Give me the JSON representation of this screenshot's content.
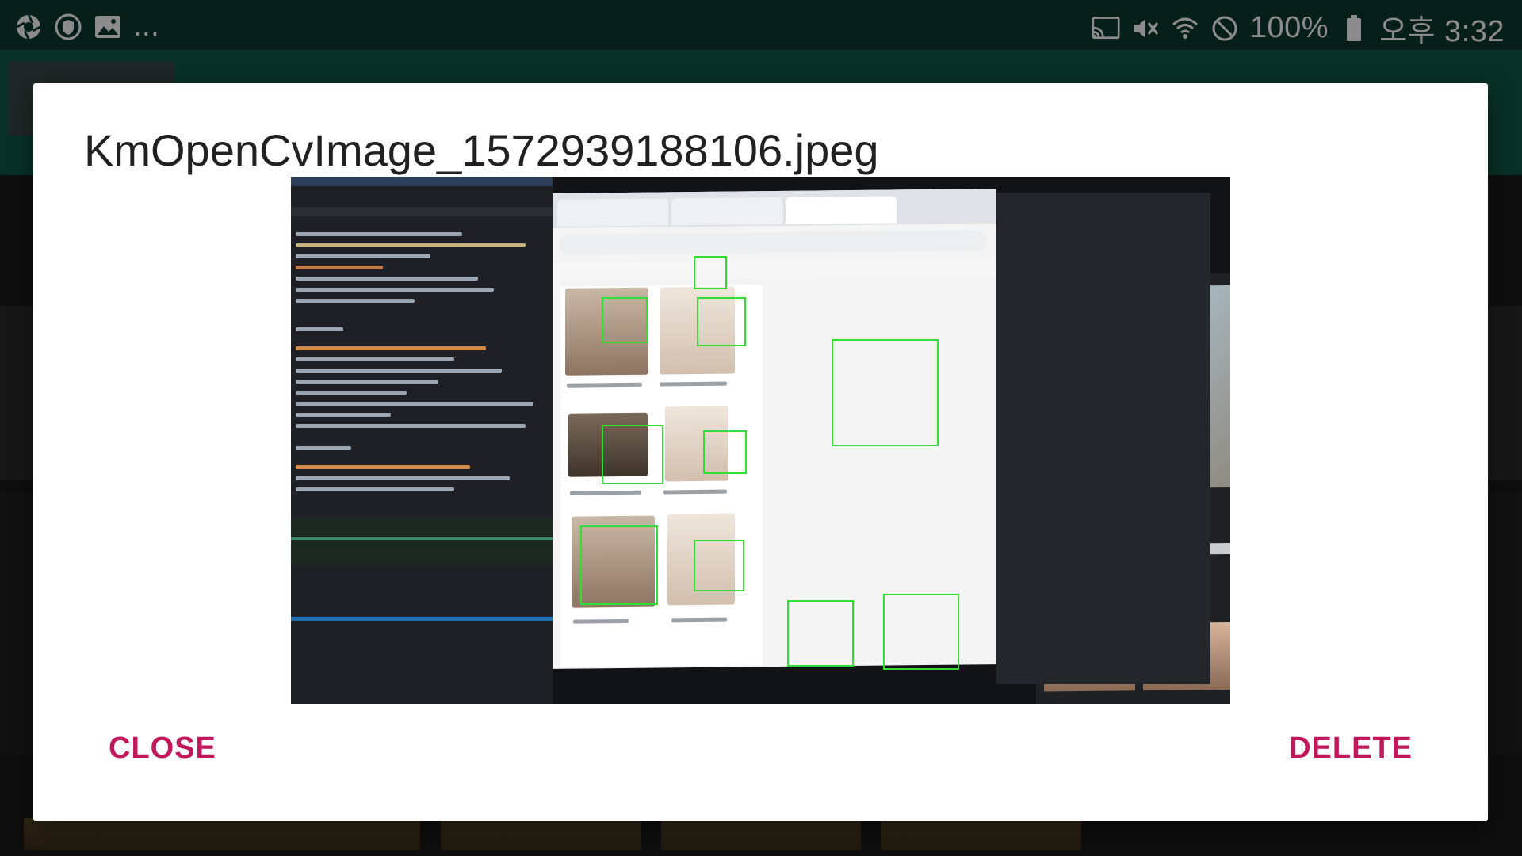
{
  "status_bar": {
    "left_icons": [
      "aperture-icon",
      "shield-icon",
      "image-icon"
    ],
    "overflow_text": "...",
    "right_icons": [
      "cast-icon",
      "mute-icon",
      "wifi-icon",
      "do-not-disturb-icon",
      "battery-icon"
    ],
    "battery_text": "100%",
    "time_text": "오후 3:32"
  },
  "dialog": {
    "title": "KmOpenCvImage_1572939188106.jpeg",
    "close_label": "CLOSE",
    "delete_label": "DELETE"
  },
  "colors": {
    "status_bar_bg": "#0e3a2e",
    "app_bar_bg": "#0f5a47",
    "button_text": "#c2185b",
    "face_box": "#33dd33"
  }
}
